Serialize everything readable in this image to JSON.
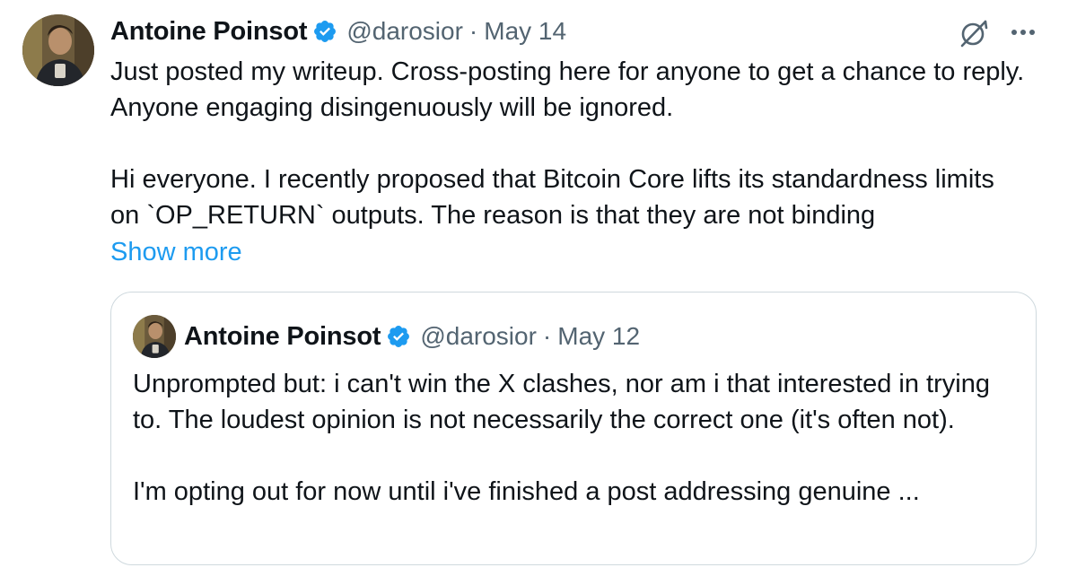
{
  "tweet": {
    "author_name": "Antoine Poinsot",
    "handle": "@darosior",
    "separator": "·",
    "date": "May 14",
    "text": "Just posted my writeup. Cross-posting here for anyone to get a chance to reply. Anyone engaging disingenuously will be ignored.\n\nHi everyone. I recently proposed that Bitcoin Core lifts its standardness limits on `OP_RETURN` outputs. The reason is that they are not binding",
    "show_more_label": "Show more",
    "icons": {
      "verified": "verified-badge-icon",
      "grok": "grok-icon",
      "more": "more-options-icon"
    }
  },
  "quoted_tweet": {
    "author_name": "Antoine Poinsot",
    "handle": "@darosior",
    "separator": "·",
    "date": "May 12",
    "text": "Unprompted but: i can't win the X clashes, nor am i that interested in trying to. The loudest opinion is not necessarily the correct one (it's often not).\n\nI'm opting out for now until i've finished a post addressing genuine ..."
  },
  "colors": {
    "text_primary": "#0f1419",
    "text_secondary": "#536471",
    "link": "#1d9bf0",
    "verified": "#1d9bf0",
    "border": "#cfd9de"
  }
}
